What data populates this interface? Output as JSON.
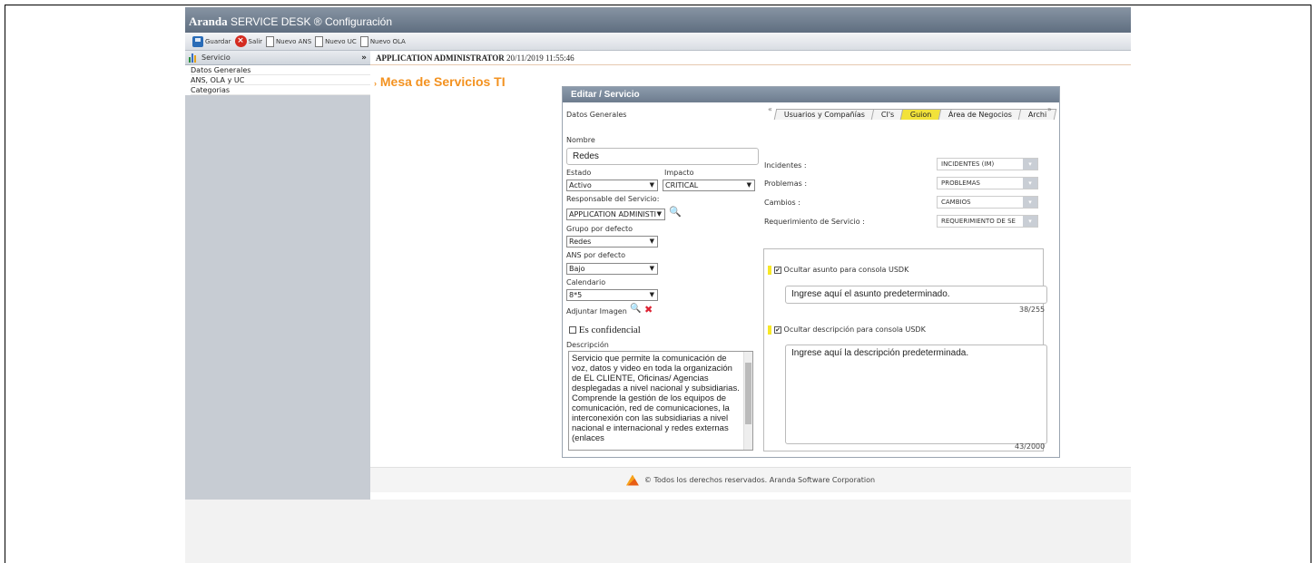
{
  "app": {
    "brand": "Aranda",
    "product": "SERVICE DESK",
    "section": "Configuración"
  },
  "toolbar": {
    "save": "Guardar",
    "exit": "Salir",
    "new_ans": "Nuevo ANS",
    "new_uc": "Nuevo UC",
    "new_ola": "Nuevo OLA"
  },
  "sidebar": {
    "header": "Servicio",
    "items": [
      "Datos Generales",
      "ANS, OLA y UC",
      "Categorias"
    ]
  },
  "userbar": {
    "user": "APPLICATION ADMINISTRATOR",
    "datetime": "20/11/2019 11:55:46"
  },
  "page_title": "Mesa de Servicios TI",
  "dialog": {
    "title": "Editar / Servicio",
    "section_label": "Datos Generales",
    "tabs": [
      "Usuarios y Compañías",
      "CI's",
      "Guion",
      "Área de Negocios",
      "Archi"
    ],
    "active_tab": "Guion",
    "nombre_label": "Nombre",
    "nombre_value": "Redes",
    "estado_label": "Estado",
    "estado_value": "Activo",
    "impacto_label": "Impacto",
    "impacto_value": "CRITICAL",
    "responsable_label": "Responsable del Servicio:",
    "responsable_value": "APPLICATION ADMINISTI",
    "grupo_label": "Grupo por defecto",
    "grupo_value": "Redes",
    "ans_label": "ANS por defecto",
    "ans_value": "Bajo",
    "calendario_label": "Calendario",
    "calendario_value": "8*5",
    "adjuntar_label": "Adjuntar Imagen",
    "confidencial_label": "Es confidencial",
    "descripcion_label": "Descripción",
    "descripcion_value": "Servicio que permite la comunicación de voz, datos y video en toda la organización de EL CLIENTE, Oficinas/ Agencias desplegadas a nivel nacional y subsidiarias. Comprende la gestión de los equipos de comunicación, red de comunicaciones, la interconexión con las subsidiarias a nivel nacional e internacional y redes externas (enlaces",
    "incidentes_label": "Incidentes :",
    "incidentes_value": "INCIDENTES (IM)",
    "problemas_label": "Problemas :",
    "problemas_value": "PROBLEMAS",
    "cambios_label": "Cambios :",
    "cambios_value": "CAMBIOS",
    "requerimiento_label": "Requerimiento de Servicio :",
    "requerimiento_value": "REQUERIMIENTO DE SE",
    "ocultar_asunto_label": "Ocultar asunto para consola USDK",
    "asunto_value": "Ingrese aquí el asunto predeterminado.",
    "asunto_counter": "38/255",
    "ocultar_desc_label": "Ocultar descripción para consola USDK",
    "desc_value": "Ingrese aquí la descripción predeterminada.",
    "desc_counter": "43/2000"
  },
  "footer": "© Todos los derechos reservados. Aranda Software Corporation"
}
